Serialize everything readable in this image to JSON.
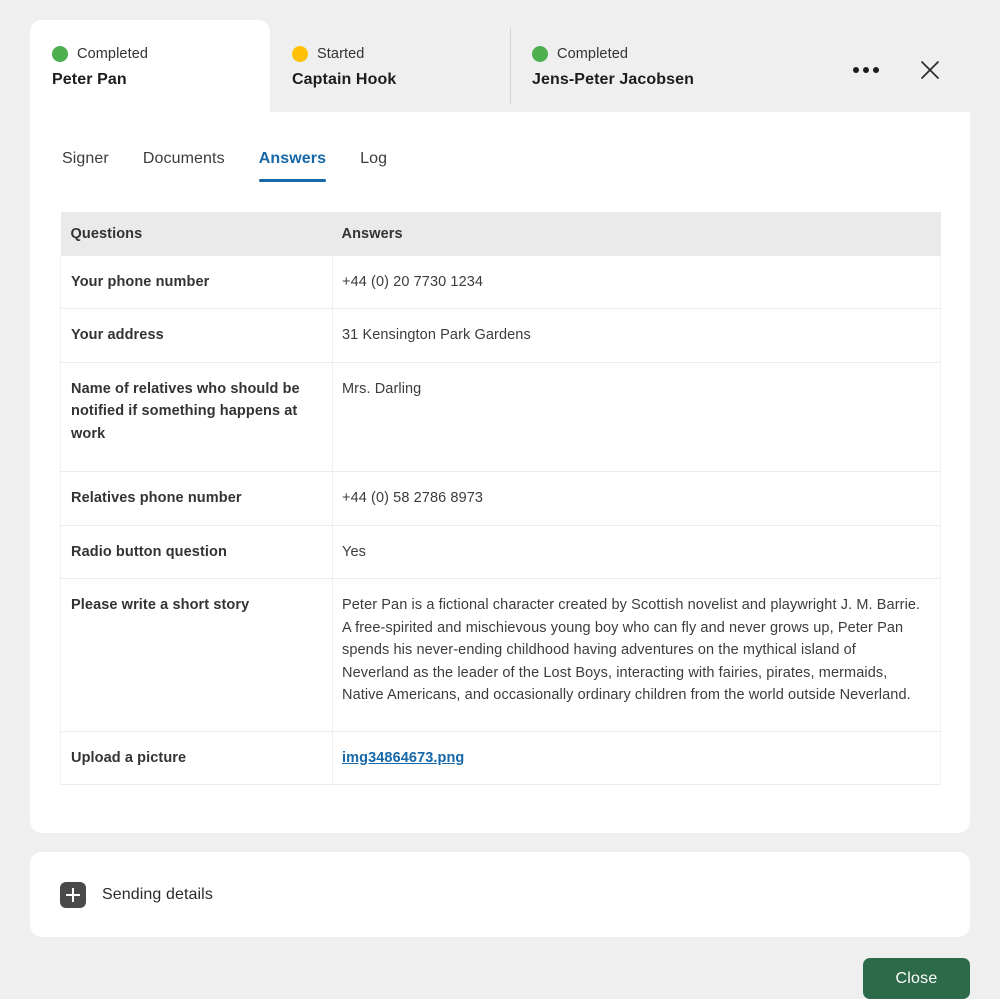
{
  "colors": {
    "accent_blue": "#1668a8",
    "status_completed": "#4caf50",
    "status_started": "#ffc107",
    "button_green": "#2d6a4a",
    "page_background": "#efefef",
    "panel_background": "#ffffff",
    "table_header": "#eaeaea"
  },
  "header": {
    "signer_tabs": [
      {
        "status": "Completed",
        "status_color": "#4caf50",
        "name": "Peter Pan",
        "active": true
      },
      {
        "status": "Started",
        "status_color": "#ffc107",
        "name": "Captain Hook",
        "active": false
      },
      {
        "status": "Completed",
        "status_color": "#4caf50",
        "name": "Jens-Peter Jacobsen",
        "active": false
      }
    ],
    "actions": [
      {
        "name": "more-options",
        "icon": "ellipsis-icon"
      },
      {
        "name": "close-dialog",
        "icon": "close-icon"
      }
    ]
  },
  "nav": {
    "tabs": [
      {
        "label": "Signer",
        "active": false
      },
      {
        "label": "Documents",
        "active": false
      },
      {
        "label": "Answers",
        "active": true
      },
      {
        "label": "Log",
        "active": false
      }
    ]
  },
  "table": {
    "columns": [
      "Questions",
      "Answers"
    ],
    "rows": [
      {
        "question": "Your phone number",
        "answer": "+44 (0) 20 7730 1234",
        "type": "text"
      },
      {
        "question": "Your address",
        "answer": "31 Kensington Park Gardens",
        "type": "text"
      },
      {
        "question": "Name of relatives who should be notified if something happens at work",
        "answer": "Mrs. Darling",
        "type": "text"
      },
      {
        "question": "Relatives phone number",
        "answer": "+44 (0) 58 2786 8973",
        "type": "text"
      },
      {
        "question": "Radio button question",
        "answer": "Yes",
        "type": "text"
      },
      {
        "question": "Please write a short story",
        "answer": "Peter Pan is a fictional character created by Scottish novelist and playwright J. M. Barrie. A free-spirited and mischievous young boy who can fly and never grows up, Peter Pan spends his never-ending childhood having adventures on the mythical island of Neverland as the leader of the Lost Boys, interacting with fairies, pirates, mermaids, Native Americans, and occasionally ordinary children from the world outside Neverland.",
        "type": "text"
      },
      {
        "question": "Upload a picture",
        "answer": "img34864673.png",
        "type": "file-link"
      }
    ]
  },
  "sending_details": {
    "label": "Sending details",
    "expand_icon": "plus-icon",
    "expanded": false
  },
  "footer": {
    "close_label": "Close"
  }
}
